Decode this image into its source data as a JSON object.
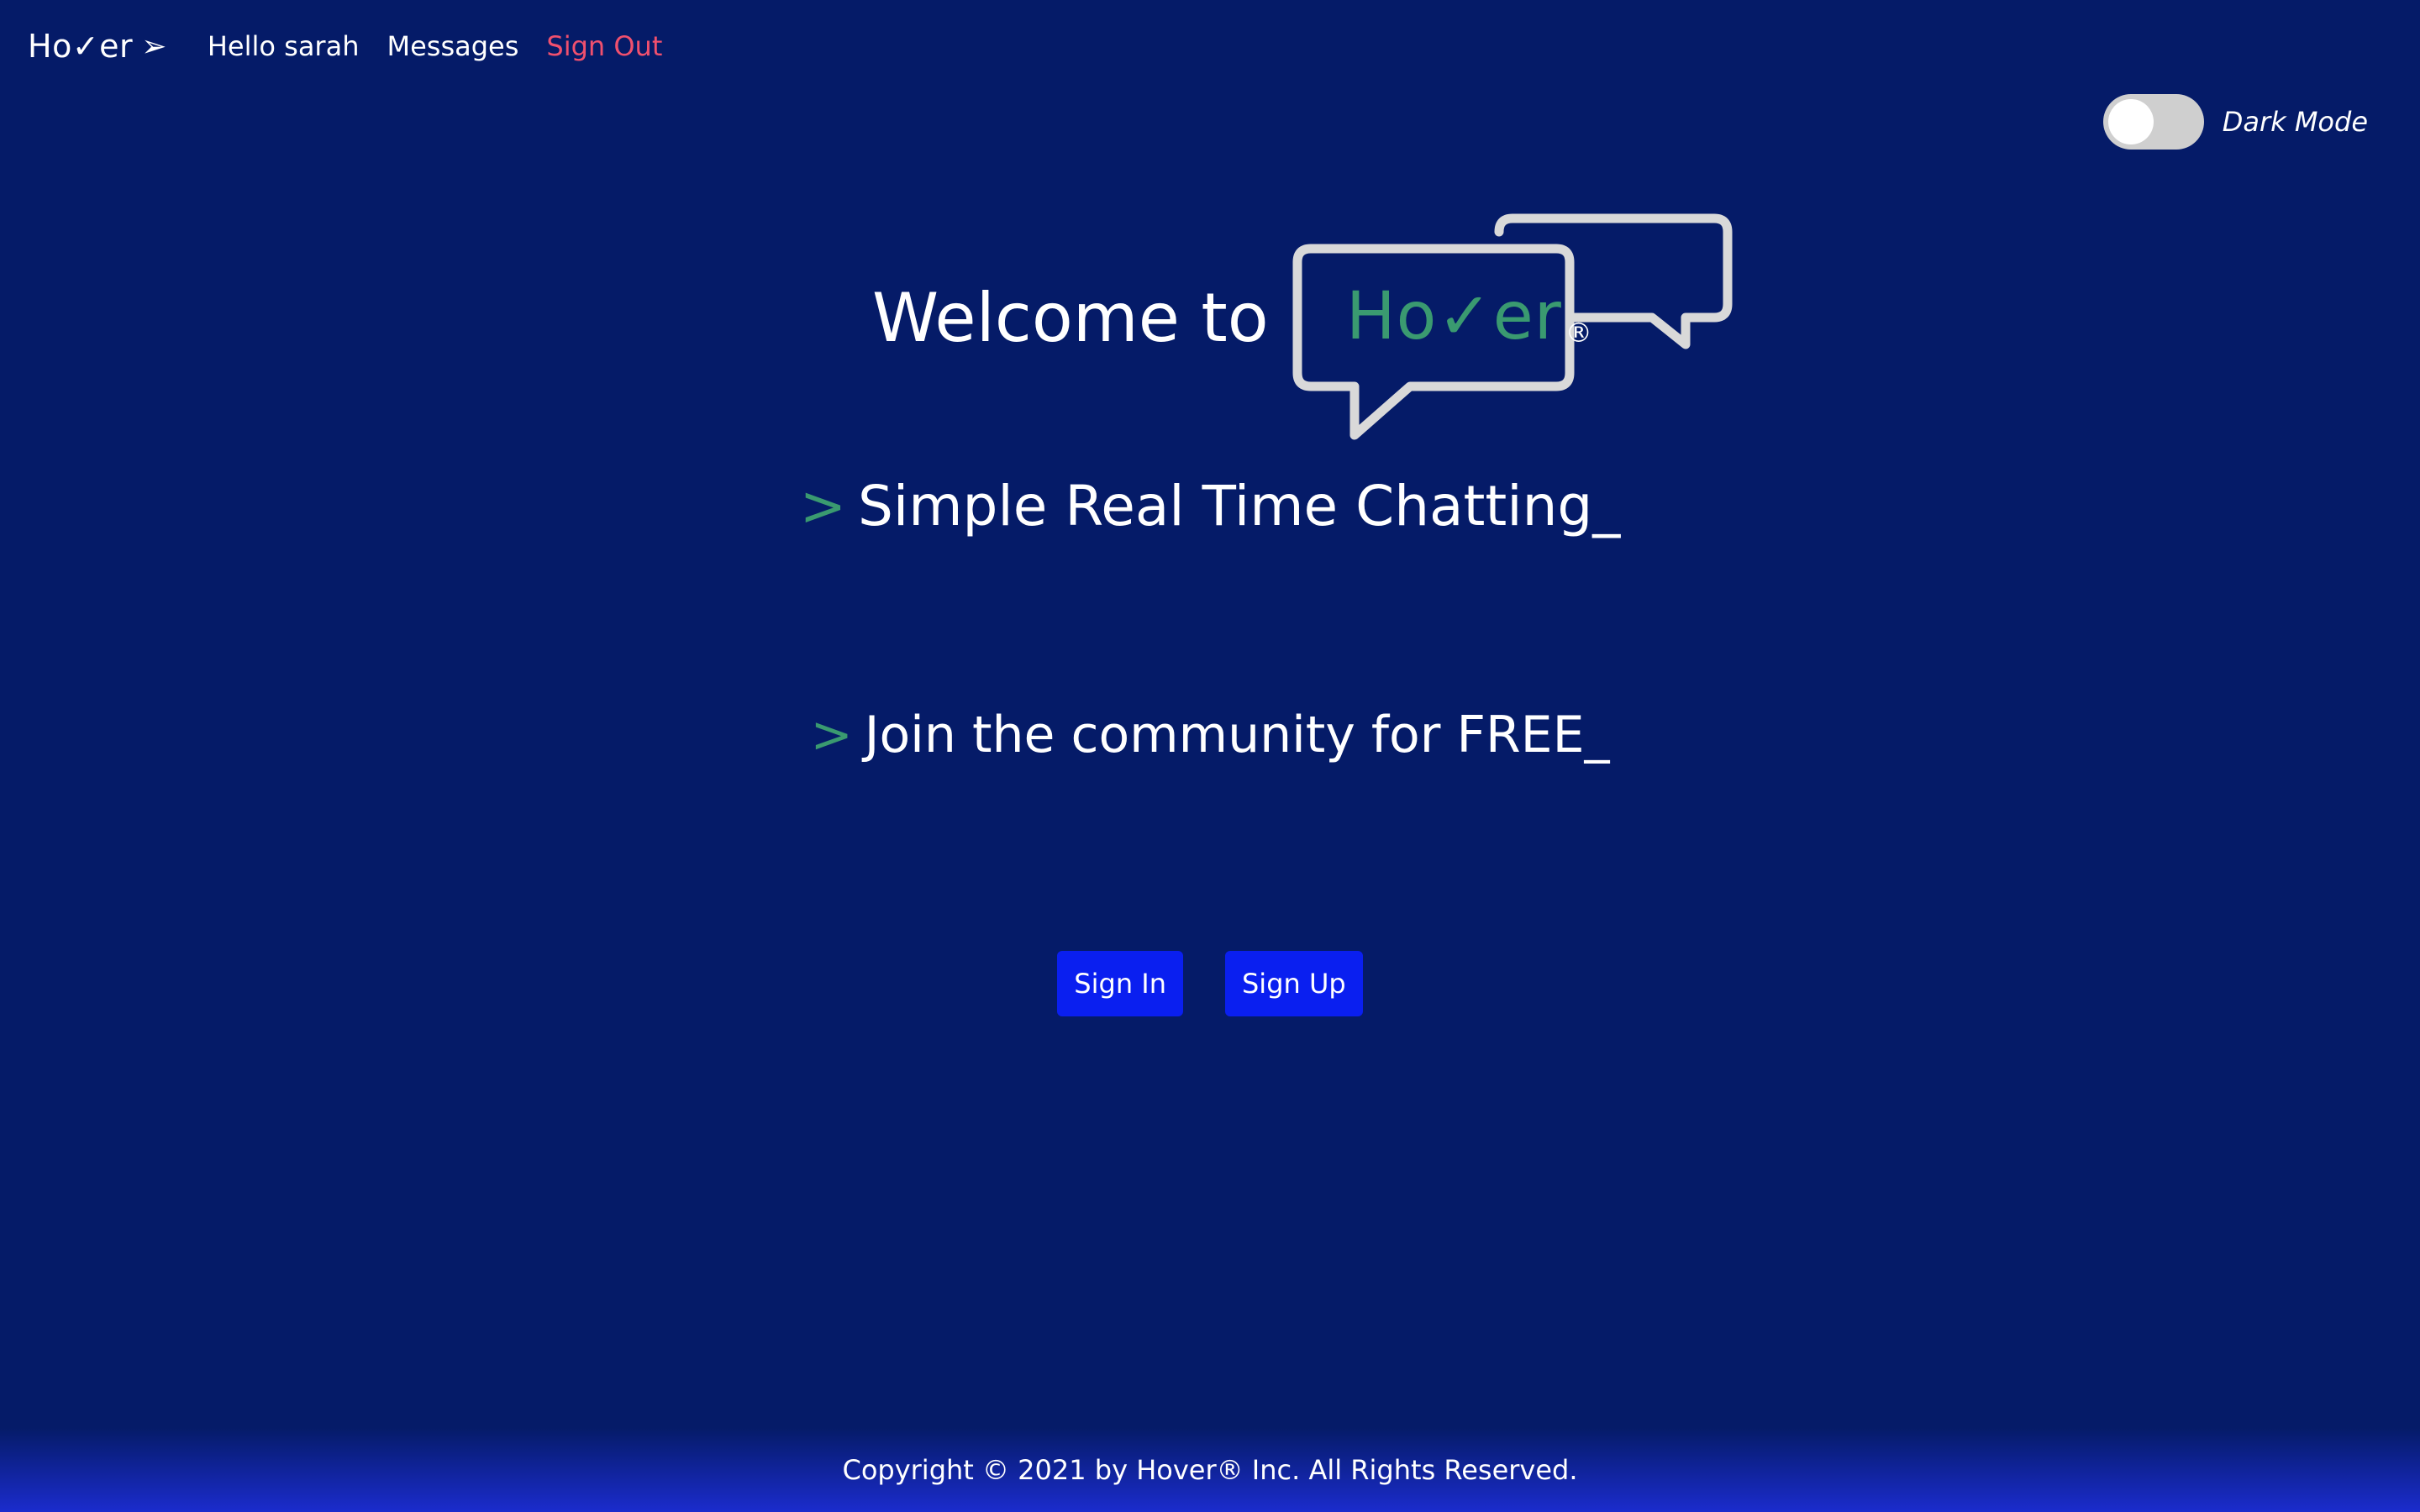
{
  "nav": {
    "brand": {
      "prefix": "Ho",
      "check": "✓",
      "suffix": "er",
      "arrow": "➢"
    },
    "greeting": "Hello sarah",
    "messages_label": "Messages",
    "signout_label": "Sign Out"
  },
  "toggle": {
    "label": "Dark Mode",
    "state": "off"
  },
  "hero": {
    "welcome": "Welcome to",
    "logo": {
      "prefix": "Ho",
      "check": "✓",
      "suffix": "er",
      "reg": "®"
    },
    "tagline_1_prompt": ">",
    "tagline_1": "Simple Real Time Chatting_",
    "tagline_2_prompt": ">",
    "tagline_2": "Join the community for FREE_"
  },
  "buttons": {
    "signin_label": "Sign In",
    "signup_label": "Sign Up"
  },
  "footer": {
    "copyright": "Copyright © 2021 by Hover® Inc. All Rights Reserved."
  },
  "colors": {
    "background": "#051b68",
    "accent_green": "#3a9a70",
    "signout_red": "#f0506e",
    "button_blue": "#0a1ff0"
  }
}
